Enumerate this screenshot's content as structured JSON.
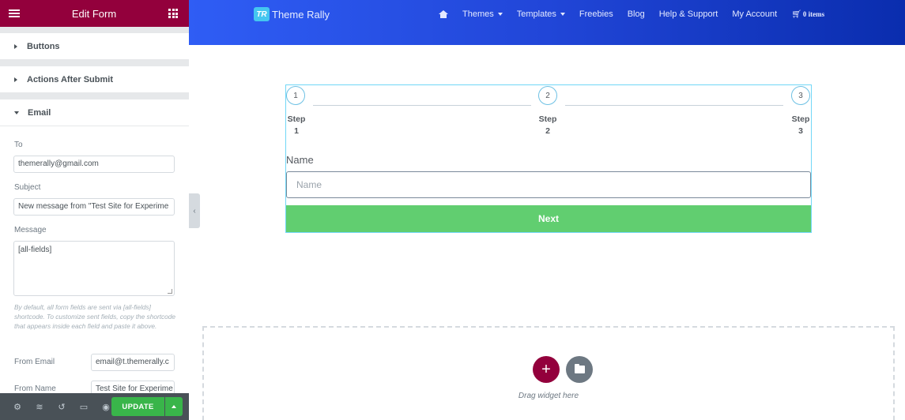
{
  "panel": {
    "header_title": "Edit Form",
    "sections": {
      "buttons": "Buttons",
      "actions": "Actions After Submit",
      "email": "Email"
    },
    "to_label": "To",
    "to_value": "themerally@gmail.com",
    "subject_label": "Subject",
    "subject_value": "New message from \"Test Site for Experime",
    "message_label": "Message",
    "message_value": "[all-fields]",
    "help_text": "By default, all form fields are sent via [all-fields] shortcode. To customize sent fields, copy the shortcode that appears inside each field and paste it above.",
    "from_email_label": "From Email",
    "from_email_value": "email@t.themerally.c",
    "from_name_label": "From Name",
    "from_name_value": "Test Site for Experime",
    "update_label": "UPDATE",
    "accent_color": "#93003c",
    "update_color": "#39b54a"
  },
  "site": {
    "logo_badge": "TR",
    "logo_text": "Theme Rally",
    "nav": {
      "themes": "Themes",
      "templates": "Templates",
      "freebies": "Freebies",
      "blog": "Blog",
      "help": "Help & Support",
      "account": "My Account",
      "cart": "0 items"
    }
  },
  "form": {
    "steps": [
      {
        "number": "1",
        "label": "Step",
        "sub": "1"
      },
      {
        "number": "2",
        "label": "Step",
        "sub": "2"
      },
      {
        "number": "3",
        "label": "Step",
        "sub": "3"
      }
    ],
    "name_label": "Name",
    "name_placeholder": "Name",
    "next_label": "Next",
    "next_color": "#61ce70"
  },
  "drop_zone": {
    "text": "Drag widget here"
  }
}
